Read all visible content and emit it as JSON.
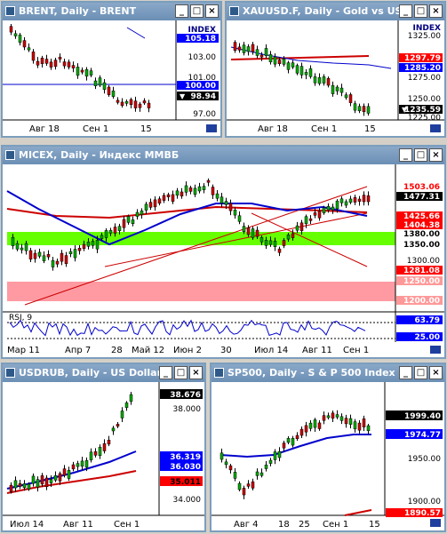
{
  "windows": {
    "brent": {
      "title": "BRENT, Daily - BRENT",
      "x_labels": [
        "Авг 18",
        "Сен 1",
        "15"
      ],
      "y_labels": [
        "103.00",
        "101.00",
        "97.00"
      ],
      "tags": [
        {
          "text": "INDEX",
          "bg": "#ffffff",
          "fg": "#000080"
        },
        {
          "text": "105.18",
          "bg": "#0000ff",
          "fg": "#ffffff"
        },
        {
          "text": "100.00",
          "bg": "#0000ff",
          "fg": "#ffffff"
        },
        {
          "text": "98.94",
          "bg": "#000000",
          "fg": "#ffffff"
        }
      ]
    },
    "gold": {
      "title": "XAUUSD.F, Daily - Gold vs US",
      "x_labels": [
        "Авг 18",
        "Сен 1",
        "15"
      ],
      "y_labels": [
        "1325.00",
        "1275.00",
        "1250.00",
        "1225.00"
      ],
      "tags": [
        {
          "text": "INDEX",
          "bg": "#ffffff",
          "fg": "#000080"
        },
        {
          "text": "1297.79",
          "bg": "#ff0000",
          "fg": "#ffffff"
        },
        {
          "text": "1285.20",
          "bg": "#0000ff",
          "fg": "#ffffff"
        },
        {
          "text": "1235.59",
          "bg": "#000000",
          "fg": "#ffffff"
        }
      ]
    },
    "micex": {
      "title": "MICEX, Daily - Индекс ММВБ",
      "x_labels": [
        "Мар 11",
        "Апр 7",
        "28",
        "Май 12",
        "Июн 2",
        "30",
        "Июл 14",
        "Авг 11",
        "Сен 1"
      ],
      "y_labels": [
        "1300.00"
      ],
      "tags": [
        {
          "text": "1503.06",
          "bg": "#ffffff",
          "fg": "#ff0000"
        },
        {
          "text": "1477.31",
          "bg": "#000000",
          "fg": "#ffffff"
        },
        {
          "text": "1425.66",
          "bg": "#ff0000",
          "fg": "#ffffff"
        },
        {
          "text": "1404.38",
          "bg": "#ff0000",
          "fg": "#ffffff"
        },
        {
          "text": "1380.00",
          "bg": "#ffffff",
          "fg": "#000000"
        },
        {
          "text": "1350.00",
          "bg": "#ffffff",
          "fg": "#000000"
        },
        {
          "text": "1281.08",
          "bg": "#ff0000",
          "fg": "#ffffff"
        },
        {
          "text": "1250.00",
          "bg": "#ff9999",
          "fg": "#ffffff"
        },
        {
          "text": "1200.00",
          "bg": "#ff9999",
          "fg": "#ffffff"
        }
      ],
      "rsi": {
        "label": "RSI, 9",
        "tags": [
          {
            "text": "63.79",
            "bg": "#0000ff",
            "fg": "#ffffff"
          },
          {
            "text": "25.00",
            "bg": "#0000ff",
            "fg": "#ffffff"
          }
        ]
      }
    },
    "usdrub": {
      "title": "USDRUB, Daily - US Dollar",
      "x_labels": [
        "Июл 14",
        "Авг 11",
        "Сен 1"
      ],
      "y_labels": [
        "38.000",
        "34.000"
      ],
      "tags": [
        {
          "text": "38.676",
          "bg": "#000000",
          "fg": "#ffffff"
        },
        {
          "text": "36.319",
          "bg": "#0000ff",
          "fg": "#ffffff"
        },
        {
          "text": "36.030",
          "bg": "#0000ff",
          "fg": "#ffffff"
        },
        {
          "text": "35.011",
          "bg": "#ff0000",
          "fg": "#000000"
        }
      ]
    },
    "sp500": {
      "title": "SP500, Daily - S & P 500 Index",
      "x_labels": [
        "Авг 4",
        "18",
        "25",
        "Сен 1",
        "15"
      ],
      "y_labels": [
        "1950.00",
        "1900.00"
      ],
      "tags": [
        {
          "text": "1999.40",
          "bg": "#000000",
          "fg": "#ffffff"
        },
        {
          "text": "1974.77",
          "bg": "#0000ff",
          "fg": "#ffffff"
        },
        {
          "text": "1890.57",
          "bg": "#ff0000",
          "fg": "#ffffff"
        }
      ]
    }
  },
  "buttons": {
    "minimize": "_",
    "maximize": "□",
    "close": "×"
  },
  "colors": {
    "title_bg": "#7b9ebd",
    "up_candle": "#00aa00",
    "down_candle": "#cc0000",
    "ma_blue": "#0000cc",
    "ma_red": "#cc0000",
    "green_zone": "#66ff00",
    "pink_zone": "#ff9aa2"
  }
}
